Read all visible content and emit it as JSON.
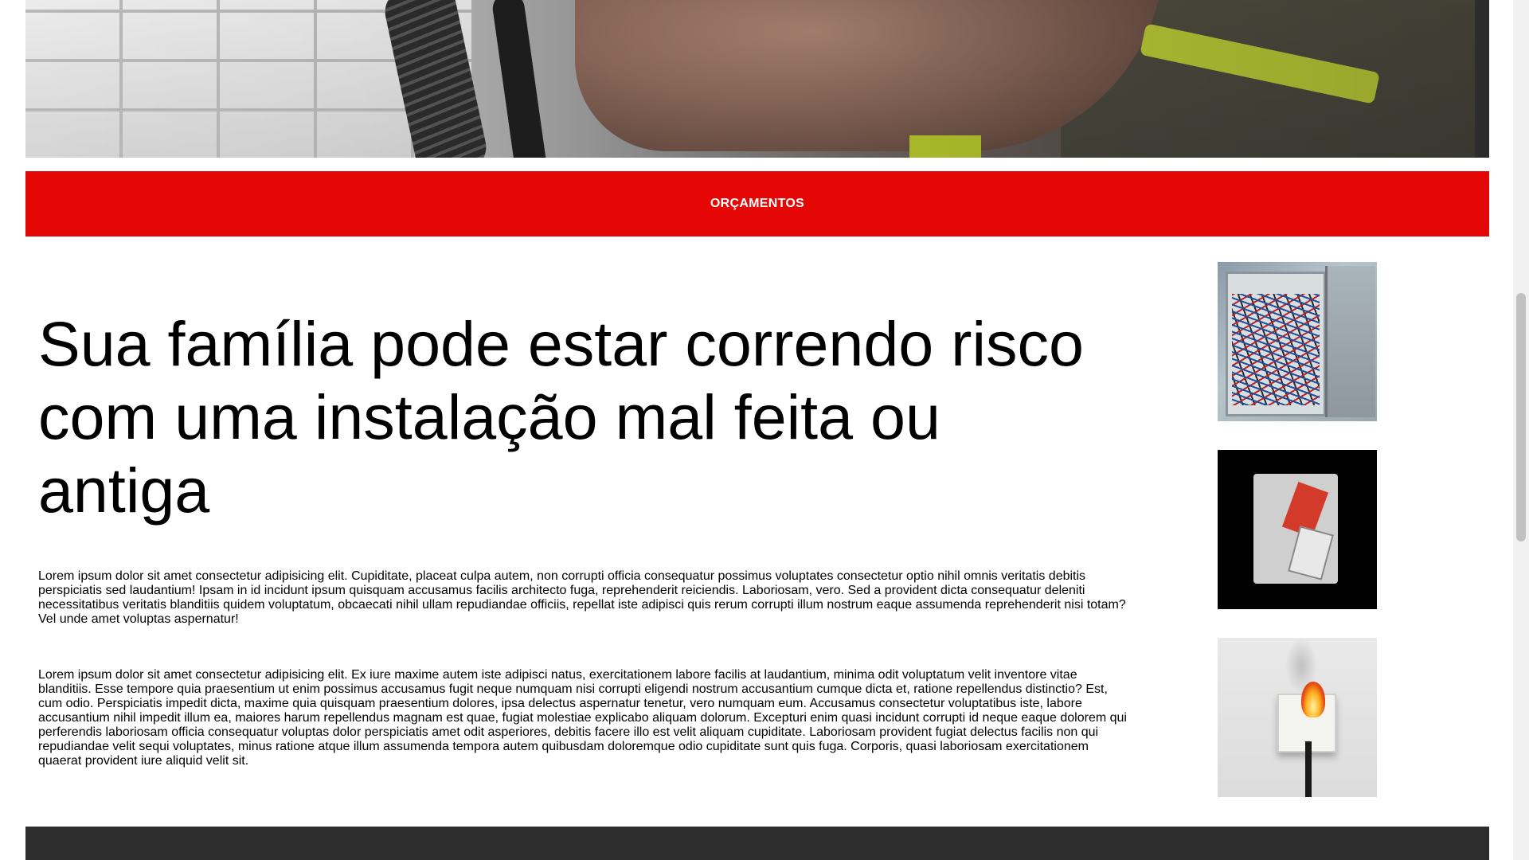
{
  "hero": {
    "image_description": ""
  },
  "cta": {
    "label": "ORÇAMENTOS",
    "color": "#e50606"
  },
  "main": {
    "headline": "Sua família pode estar correndo risco com uma instalação mal feita ou antiga",
    "paragraphs": [
      "Lorem ipsum dolor sit amet consectetur adipisicing elit. Cupiditate, placeat culpa autem, non corrupti officia consequatur possimus voluptates consectetur optio nihil omnis veritatis debitis perspiciatis sed laudantium! Ipsam in id incidunt ipsum quisquam accusamus facilis architecto fuga, reprehenderit reiciendis. Laboriosam, vero. Sed a provident dicta consequatur deleniti necessitatibus veritatis blanditiis quidem voluptatum, obcaecati nihil ullam repudiandae officiis, repellat iste adipisci quis rerum corrupti illum nostrum eaque assumenda reprehenderit nisi totam? Vel unde amet voluptas aspernatur!",
      "Lorem ipsum dolor sit amet consectetur adipisicing elit. Ex iure maxime autem iste adipisci natus, exercitationem labore facilis at laudantium, minima odit voluptatum velit inventore vitae blanditiis. Esse tempore quia praesentium ut enim possimus accusamus fugit neque numquam nisi corrupti eligendi nostrum accusantium cumque dicta et, ratione repellendus distinctio? Est, cum odio. Perspiciatis impedit dicta, maxime quia quisquam praesentium dolores, ipsa delectus aspernatur tenetur, vero numquam eum. Accusamus consectetur voluptatibus iste, labore accusantium nihil impedit illum ea, maiores harum repellendus magnam est quae, fugiat molestiae explicabo aliquam dolorum. Excepturi enim quasi incidunt corrupti id neque eaque dolorem qui perferendis laboriosam officia consequatur voluptas dolor perspiciatis amet odit asperiores, debitis facere illo est velit aliquam cupiditate. Laboriosam provident fugiat delectus facilis non qui repudiandae velit sequi voluptates, minus ratione atque illum assumenda tempora autem quibusdam doloremque odio cupiditate sunt quis fuga. Corporis, quasi laboriosam exercitationem quaerat provident iure aliquid velit sit."
    ]
  },
  "side_images": [
    {
      "icon": "electrical-panel-photo"
    },
    {
      "icon": "overloaded-outlet-photo"
    },
    {
      "icon": "burning-socket-photo"
    }
  ],
  "footer": {
    "color": "#2d2d2d"
  }
}
